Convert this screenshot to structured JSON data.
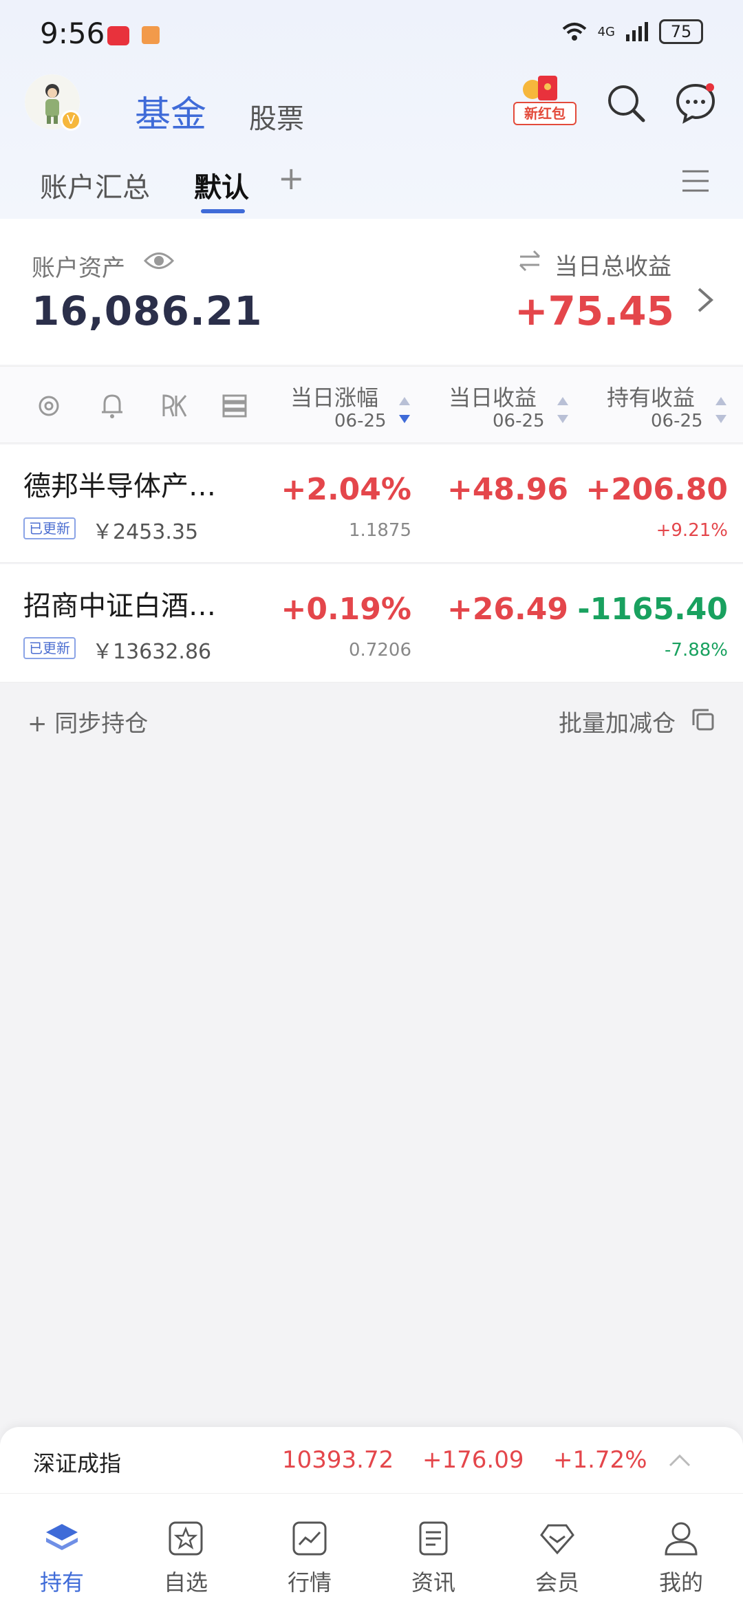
{
  "status_bar": {
    "time": "9:56",
    "network": "4G",
    "battery": "75"
  },
  "top_nav": {
    "tab_fund": "基金",
    "tab_stock": "股票",
    "red_packet": "新红包"
  },
  "account_tabs": {
    "summary": "账户汇总",
    "default": "默认",
    "add": "+"
  },
  "account_summary": {
    "asset_label": "账户资产",
    "asset_value": "16,086.21",
    "profit_label": "当日总收益",
    "profit_value": "+75.45"
  },
  "columns": {
    "daily_change": "当日涨幅",
    "daily_profit": "当日收益",
    "holding_profit": "持有收益",
    "date": "06-25"
  },
  "funds": [
    {
      "name": "德邦半导体产…",
      "badge": "已更新",
      "amount": "￥2453.35",
      "daily_change": "+2.04%",
      "nav": "1.1875",
      "daily_profit": "+48.96",
      "holding_profit": "+206.80",
      "holding_pct": "+9.21%"
    },
    {
      "name": "招商中证白酒…",
      "badge": "已更新",
      "amount": "￥13632.86",
      "daily_change": "+0.19%",
      "nav": "0.7206",
      "daily_profit": "+26.49",
      "holding_profit": "-1165.40",
      "holding_pct": "-7.88%"
    }
  ],
  "actions": {
    "sync": "+ 同步持仓",
    "batch": "批量加减仓"
  },
  "ticker": {
    "name": "深证成指",
    "value": "10393.72",
    "change": "+176.09",
    "pct": "+1.72%"
  },
  "bottom_nav": [
    {
      "label": "持有",
      "icon": "layers-icon"
    },
    {
      "label": "自选",
      "icon": "star-icon"
    },
    {
      "label": "行情",
      "icon": "chart-icon"
    },
    {
      "label": "资讯",
      "icon": "document-icon"
    },
    {
      "label": "会员",
      "icon": "diamond-icon"
    },
    {
      "label": "我的",
      "icon": "profile-icon"
    }
  ],
  "colors": {
    "accent": "#3f6bd8",
    "up": "#e4464b",
    "down": "#19a15f"
  }
}
